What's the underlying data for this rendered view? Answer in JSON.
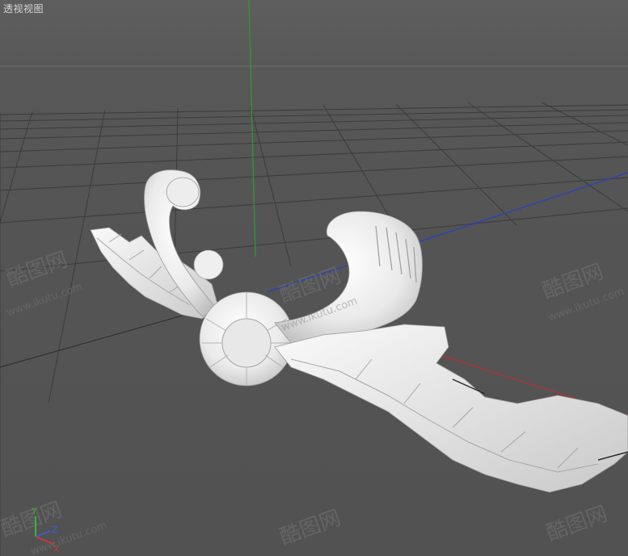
{
  "viewport": {
    "title": "透视视图"
  },
  "axis_gizmo": {
    "y_label": "Y",
    "z_label": "Z",
    "x_label": "X",
    "colors": {
      "x": "#c83a3a",
      "y": "#3ab53a",
      "z": "#3a5fd8"
    }
  },
  "watermark": {
    "brand": "酷图网",
    "url": "www.ikutu.com"
  },
  "colors": {
    "background": "#555555",
    "grid": "#3a3a3a",
    "green_axis": "#2f9a2f",
    "blue_axis": "#2b3fc4",
    "red_axis": "#b83030",
    "model": "#f2f2f2"
  }
}
